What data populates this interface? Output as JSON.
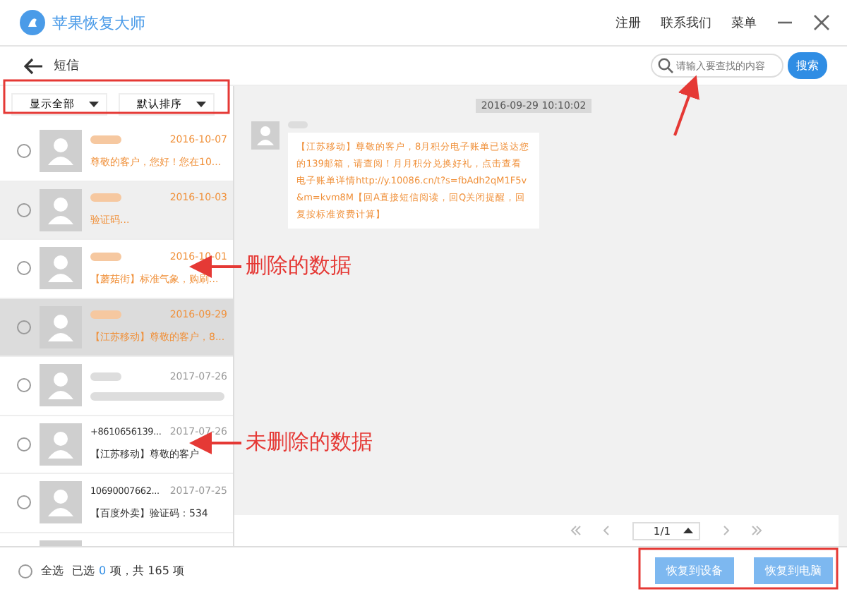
{
  "window": {
    "title": "苹果恢复大师",
    "menu": [
      "注册",
      "联系我们",
      "菜单"
    ]
  },
  "header": {
    "back_label": "短信",
    "search": {
      "placeholder": "请输入要查找的内容",
      "button": "搜索"
    }
  },
  "filters": [
    "显示全部",
    "默认排序"
  ],
  "messages": [
    {
      "date": "2016-10-07",
      "preview": "尊敬的客户，您好！您在10...",
      "deleted": true,
      "shaded": false,
      "selected": false,
      "blurred_preview": false
    },
    {
      "date": "2016-10-03",
      "preview": "验证码...",
      "deleted": true,
      "shaded": true,
      "selected": false,
      "blurred_preview": false
    },
    {
      "date": "2016-10-01",
      "preview": "【蘑菇街】标准气象，购刷...",
      "deleted": true,
      "shaded": false,
      "selected": false,
      "blurred_preview": false
    },
    {
      "date": "2016-09-29",
      "preview": "【江苏移动】尊敬的客户，8...",
      "deleted": true,
      "shaded": false,
      "selected": true,
      "blurred_preview": false
    },
    {
      "date": "2017-07-26",
      "deleted": false,
      "shaded": false,
      "selected": false,
      "blurred_preview": true
    },
    {
      "sender": "+8610656139...",
      "date": "2017-07-26",
      "preview": "【江苏移动】尊敬的客户",
      "deleted": false,
      "shaded": false,
      "selected": false,
      "blurred_preview": false
    },
    {
      "sender": "10690007662...",
      "date": "2017-07-25",
      "preview": "【百度外卖】验证码：534",
      "deleted": false,
      "shaded": false,
      "selected": false,
      "blurred_preview": false
    }
  ],
  "chat": {
    "timestamp": "2016-09-29 10:10:02",
    "bubble": "【江苏移动】尊敬的客户，8月积分电子账单已送达您的139邮箱，请查阅！月月积分兑换好礼，点击查看电子账单详情http://y.10086.cn/t?s=fbAdh2qM1F5v&m=kvm8M【回A直接短信阅读，回Q关闭提醒，回复按标准资费计算】"
  },
  "pager": {
    "page": "1/1"
  },
  "footer": {
    "select_all": "全选",
    "select_all_checked": false,
    "selected_prefix": "已选",
    "selected_count": "0",
    "total": "项，共 165 项",
    "buttons": [
      "恢复到设备",
      "恢复到电脑"
    ]
  },
  "annotations": [
    "删除的数据",
    "未删除的数据"
  ]
}
